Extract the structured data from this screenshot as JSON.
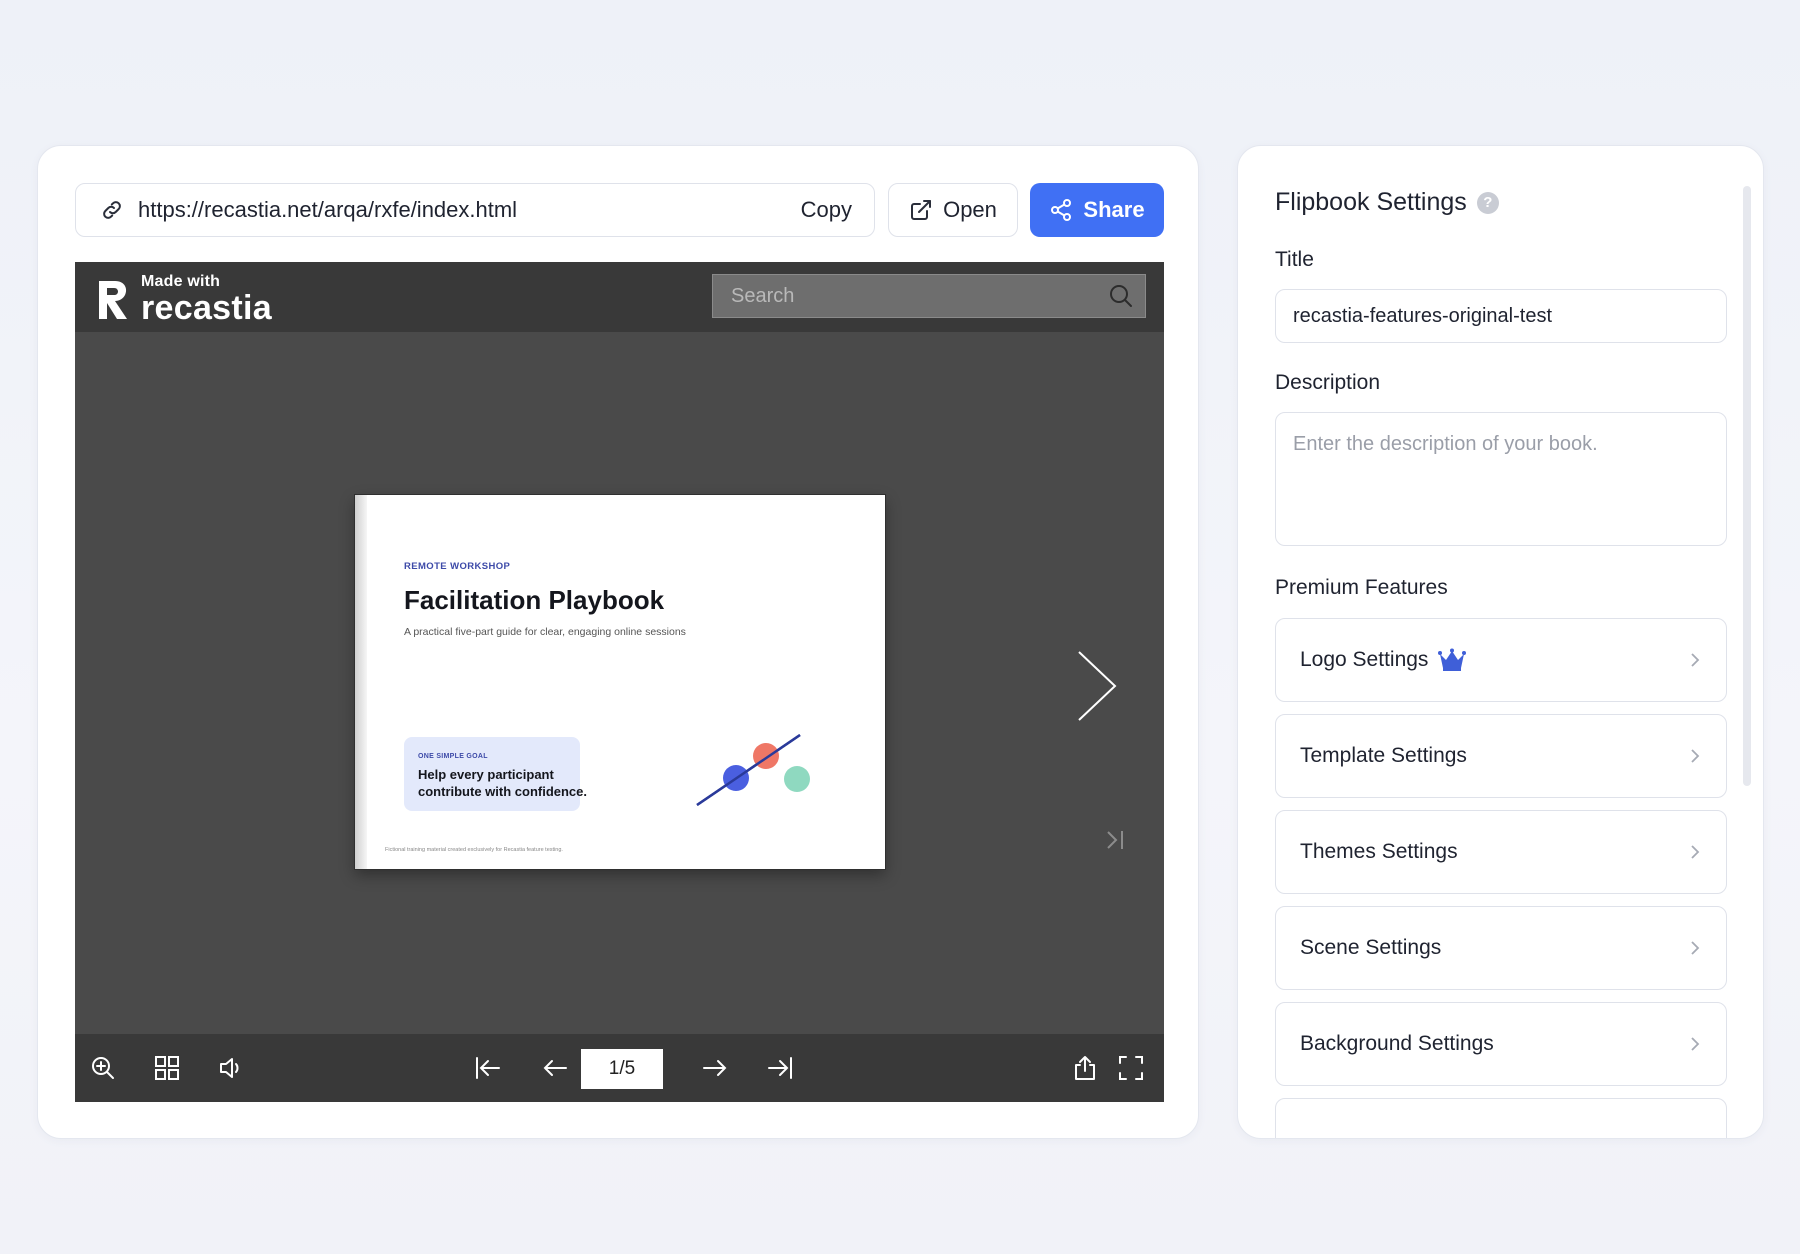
{
  "share_bar": {
    "url": "https://recastia.net/arqa/rxfe/index.html",
    "copy_label": "Copy",
    "open_label": "Open",
    "share_label": "Share",
    "share_color": "#4070f4"
  },
  "viewer": {
    "brand_made_with": "Made with",
    "brand_name": "recastia",
    "search_placeholder": "Search",
    "page_indicator": "1/5",
    "page": {
      "eyebrow": "REMOTE WORKSHOP",
      "title": "Facilitation Playbook",
      "subtitle": "A practical five-part guide for clear, engaging online sessions",
      "goal_eyebrow": "ONE SIMPLE GOAL",
      "goal_text": "Help every participant contribute with confidence.",
      "footer": "Fictional training material created exclusively for Recastia feature testing."
    },
    "toolbar_icons": [
      "zoom-in-icon",
      "grid-icon",
      "sound-icon",
      "first-page-icon",
      "prev-page-icon",
      "next-page-icon",
      "last-page-icon",
      "share-icon",
      "fullscreen-icon"
    ]
  },
  "settings": {
    "heading": "Flipbook Settings",
    "help_symbol": "?",
    "title_label": "Title",
    "title_value": "recastia-features-original-test",
    "description_label": "Description",
    "description_placeholder": "Enter the description of your book.",
    "premium_label": "Premium Features",
    "features": [
      {
        "label": "Logo Settings",
        "premium_icon": "crown-icon"
      },
      {
        "label": "Template Settings"
      },
      {
        "label": "Themes Settings"
      },
      {
        "label": "Scene Settings"
      },
      {
        "label": "Background Settings"
      }
    ]
  }
}
